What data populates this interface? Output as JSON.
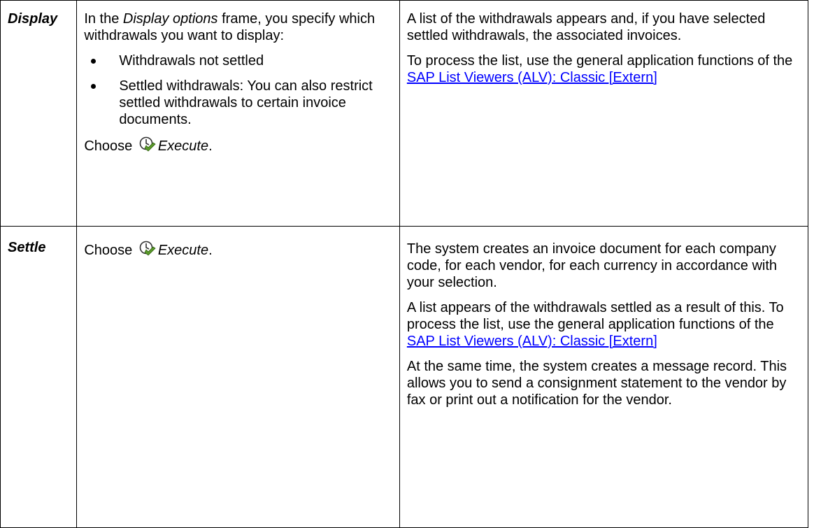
{
  "rows": [
    {
      "step": "Display",
      "action": {
        "intro_pre": "In the ",
        "intro_em": "Display options",
        "intro_post": " frame, you specify which withdrawals you want to display:",
        "bullets": [
          "Withdrawals not settled",
          "Settled withdrawals: You can also restrict settled withdrawals to certain invoice documents."
        ],
        "choose_pre": "Choose ",
        "choose_em": "Execute",
        "choose_post": ".",
        "icon": "execute-icon"
      },
      "result": {
        "para1": "A list of the withdrawals appears and, if you have selected settled withdrawals, the associated invoices.",
        "para2_pre": "To process the list, use the general application functions of the ",
        "link": "SAP List Viewers (ALV): Classic [Extern]"
      }
    },
    {
      "step": "Settle",
      "action": {
        "choose_pre": "Choose ",
        "choose_em": "Execute",
        "choose_post": ".",
        "icon": "execute-icon"
      },
      "result": {
        "para1": "The system creates an invoice document for each company code, for each vendor, for each currency in accordance with your selection.",
        "para2_pre": "A list appears of the withdrawals settled as a result of this. To process the list, use the general application functions of the ",
        "link": "SAP List Viewers (ALV): Classic [Extern]",
        "para3": "At the same time, the system creates a message record. This allows you to send a consignment statement to the vendor by fax or print out a notification for the vendor."
      }
    }
  ],
  "colors": {
    "link": "#0000ff",
    "border": "#000000",
    "icon_green": "#5a9a2a"
  }
}
